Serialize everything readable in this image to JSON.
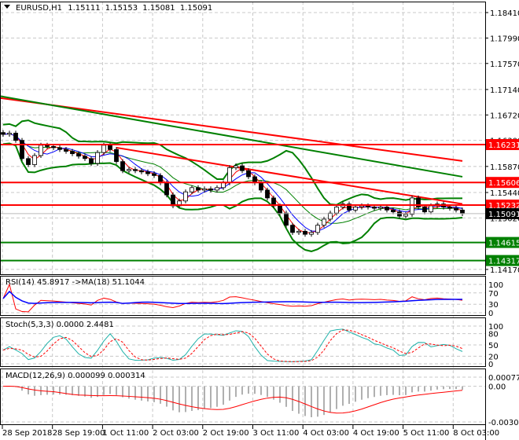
{
  "header": {
    "symbol": "EURUSD,H1",
    "open": "1.15111",
    "high": "1.15153",
    "low": "1.15081",
    "close": "1.15091"
  },
  "indicators": {
    "rsi_label": "RSI(14) 45.8917  ->MA(18) 51.1044",
    "stoch_label": "Stoch(5,3,3) 0.0000 2.4481",
    "macd_label": "MACD(12,26,9) 0.000099 0.000314"
  },
  "chart_data": {
    "type": "candlestick",
    "title": "EURUSD,H1",
    "price_axis_ticks": [
      "1.18410",
      "1.17990",
      "1.17570",
      "1.17140",
      "1.16720",
      "1.16300",
      "1.15870",
      "1.15440",
      "1.15020",
      "1.14170"
    ],
    "ylim": [
      1.1409,
      1.1858
    ],
    "time_axis_ticks": [
      "28 Sep 2018",
      "28 Sep 19:00",
      "1 Oct 11:00",
      "2 Oct 03:00",
      "2 Oct 19:00",
      "3 Oct 11:00",
      "4 Oct 03:00",
      "4 Oct 19:00",
      "5 Oct 11:00",
      "8 Oct 03:00"
    ],
    "closes": [
      1.164,
      1.1642,
      1.163,
      1.16,
      1.159,
      1.1605,
      1.1622,
      1.162,
      1.1618,
      1.1615,
      1.1612,
      1.1608,
      1.1604,
      1.16,
      1.1592,
      1.161,
      1.1622,
      1.1615,
      1.1595,
      1.158,
      1.1582,
      1.158,
      1.1578,
      1.1575,
      1.1572,
      1.156,
      1.154,
      1.1522,
      1.153,
      1.1545,
      1.1552,
      1.1548,
      1.155,
      1.1548,
      1.1552,
      1.156,
      1.1585,
      1.1588,
      1.158,
      1.157,
      1.156,
      1.1548,
      1.1535,
      1.1522,
      1.151,
      1.149,
      1.1478,
      1.148,
      1.1475,
      1.1478,
      1.149,
      1.15,
      1.151,
      1.152,
      1.1525,
      1.1515,
      1.152,
      1.1522,
      1.152,
      1.1518,
      1.152,
      1.1515,
      1.1512,
      1.1505,
      1.1508,
      1.1535,
      1.152,
      1.1512,
      1.1522,
      1.1525,
      1.152,
      1.1518,
      1.1515,
      1.15091
    ],
    "levels": [
      {
        "price": "1.16231",
        "color": "#ff0000"
      },
      {
        "price": "1.15606",
        "color": "#ff0000"
      },
      {
        "price": "1.15232",
        "color": "#ff0000"
      },
      {
        "price": "1.14615",
        "color": "#008000"
      },
      {
        "price": "1.14317",
        "color": "#008000"
      }
    ],
    "trendlines": [
      {
        "from_bar": 0,
        "from_price": 1.17,
        "to_bar": 73,
        "to_price": 1.1596,
        "color": "#ff0000"
      },
      {
        "from_bar": 18,
        "from_price": 1.1618,
        "to_bar": 73,
        "to_price": 1.1525,
        "color": "#ff0000"
      },
      {
        "from_bar": 0,
        "from_price": 1.1703,
        "to_bar": 73,
        "to_price": 1.157,
        "color": "#008000"
      }
    ],
    "last_price": "1.15091",
    "rsi": {
      "ticks": [
        "100",
        "70",
        "30",
        "0"
      ],
      "ylim": [
        0,
        100
      ]
    },
    "stoch": {
      "ticks": [
        "100",
        "80",
        "50",
        "20",
        "0"
      ],
      "ylim": [
        0,
        100
      ]
    },
    "macd": {
      "ticks": [
        "0.000775",
        "0.00",
        "-0.00302"
      ],
      "ylim": [
        -0.00302,
        0.000775
      ]
    }
  }
}
